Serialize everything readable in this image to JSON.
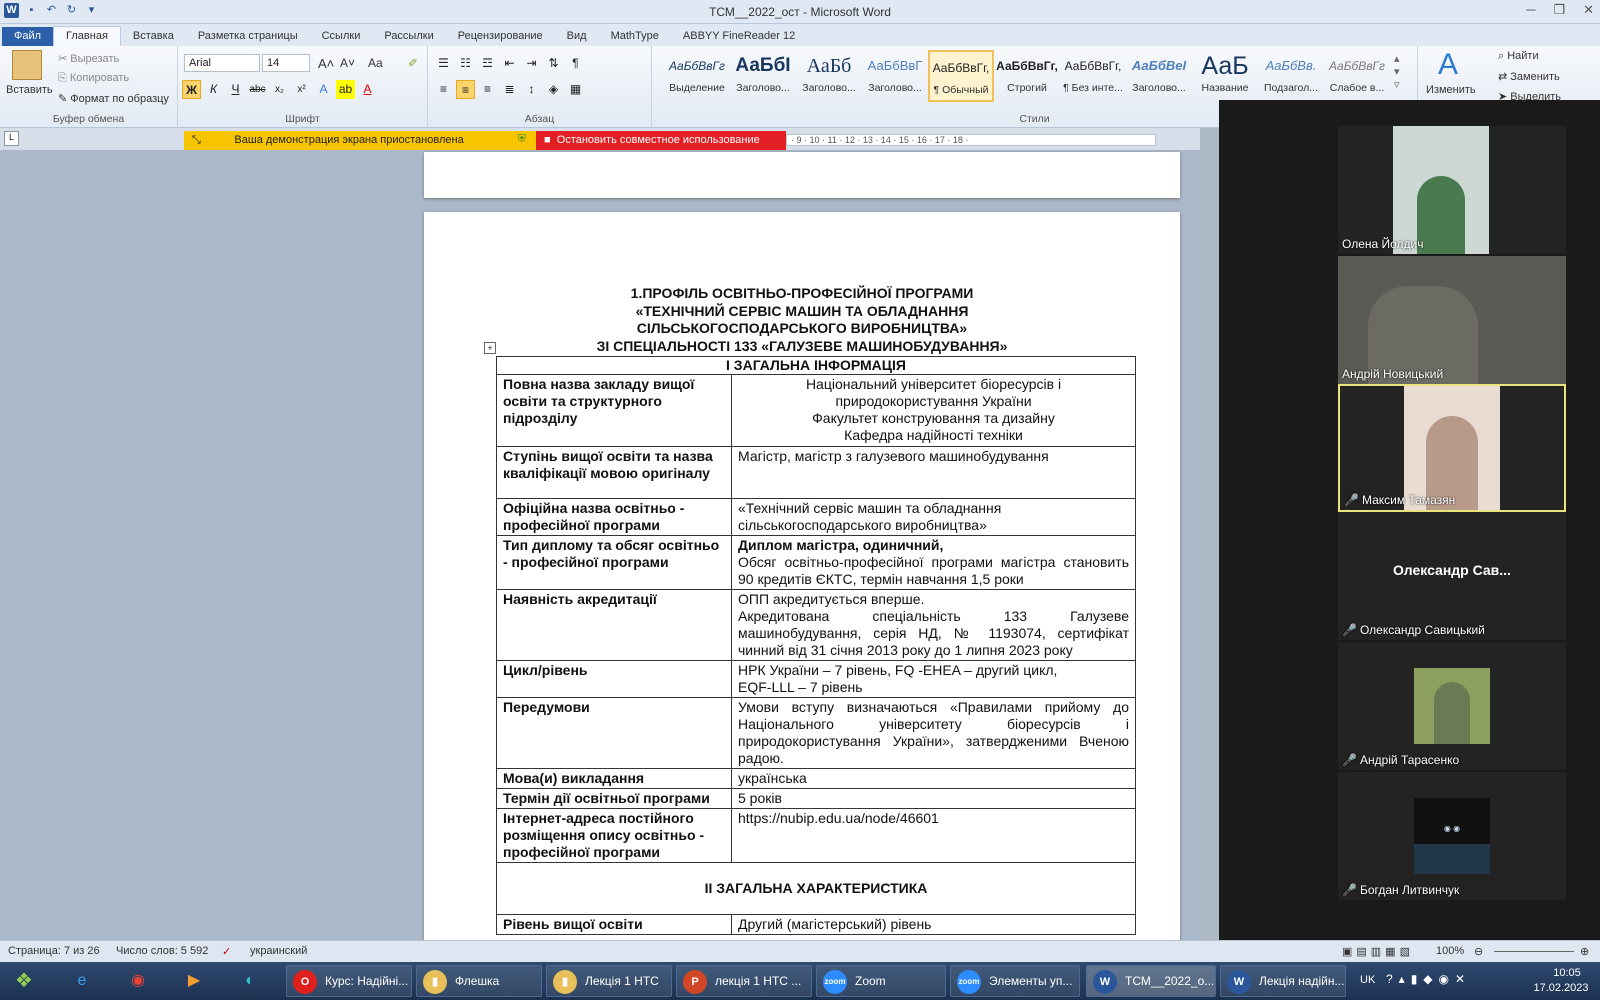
{
  "window": {
    "title": "ТСМ__2022_ост  -  Microsoft Word",
    "app_icon": "W"
  },
  "tabs": [
    "Файл",
    "Главная",
    "Вставка",
    "Разметка страницы",
    "Ссылки",
    "Рассылки",
    "Рецензирование",
    "Вид",
    "MathType",
    "ABBYY FineReader 12"
  ],
  "clipboard": {
    "paste": "Вставить",
    "cut": "Вырезать",
    "copy": "Копировать",
    "painter": "Формат по образцу",
    "label": "Буфер обмена"
  },
  "font": {
    "name": "Arial",
    "size": "14",
    "label": "Шрифт",
    "case_label": "Aa"
  },
  "paragraph": {
    "label": "Абзац"
  },
  "styles": {
    "label": "Стили",
    "items": [
      {
        "sample": "АаБбВвГг",
        "name": "Выделение"
      },
      {
        "sample": "АаБбІ",
        "name": "Заголово..."
      },
      {
        "sample": "АаБб",
        "name": "Заголово..."
      },
      {
        "sample": "АаБбВвГ",
        "name": "Заголово..."
      },
      {
        "sample": "АаБбВвГг,",
        "name": "¶ Обычный"
      },
      {
        "sample": "АаБбВвГг,",
        "name": "Строгий"
      },
      {
        "sample": "АаБбВвГг,",
        "name": "¶ Без инте..."
      },
      {
        "sample": "АаБбВеІ",
        "name": "Заголово..."
      },
      {
        "sample": "АаБ",
        "name": "Название"
      },
      {
        "sample": "АаБбВв.",
        "name": "Подзагол..."
      },
      {
        "sample": "АаБбВвГг",
        "name": "Слабое в..."
      }
    ],
    "change": "Изменить"
  },
  "editing": {
    "find": "Найти",
    "replace": "Заменить",
    "select": "Выделить"
  },
  "share": {
    "paused": "Ваша демонстрация экрана приостановлена",
    "stop": "Остановить совместное использование"
  },
  "ruler": "· 9 · 10 · 11 · 12 · 13 · 14 · 15 · 16 · 17 · 18 ·",
  "document": {
    "title_lines": [
      "1.ПРОФІЛЬ ОСВІТНЬО-ПРОФЕСІЙНОЇ ПРОГРАМИ",
      "«ТЕХНІЧНИЙ СЕРВІС МАШИН ТА ОБЛАДНАННЯ",
      "СІЛЬСЬКОГОСПОДАРСЬКОГО ВИРОБНИЦТВА»",
      "ЗІ СПЕЦІАЛЬНОСТІ 133 «ГАЛУЗЕВЕ МАШИНОБУДУВАННЯ»"
    ],
    "section1": "І  ЗАГАЛЬНА ІНФОРМАЦІЯ",
    "rows": [
      {
        "key": "Повна назва закладу вищої освіти та структурного підрозділу",
        "value": [
          "Національний університет біоресурсів і",
          "природокористування України",
          "Факультет конструювання та дизайну",
          "Кафедра надійності техніки"
        ]
      },
      {
        "key": "Ступінь вищої освіти та назва кваліфікації мовою оригіналу",
        "value": [
          "Магістр, магістр з галузевого машинобудування"
        ]
      },
      {
        "key": "Офіційна назва освітньо - професійної програми",
        "value": [
          "«Технічний сервіс машин та обладнання сільськогосподарського виробництва»"
        ]
      },
      {
        "key": "Тип диплому та обсяг освітньо - професійної програми",
        "value_bold": "Диплом магістра, одиничний,",
        "value": [
          "Обсяг освітньо-професійної програми магістра становить 90 кредитів ЄКТС, термін навчання 1,5 роки"
        ]
      },
      {
        "key": "Наявність акредитації",
        "value": [
          "ОПП акредитується вперше.",
          "Акредитована спеціальність 133 Галузеве машинобудування, серія НД, № 1193074, сертифікат чинний від 31 січня 2013 року до 1 липня 2023 року"
        ]
      },
      {
        "key": "Цикл/рівень",
        "value": [
          "НРК України – 7 рівень, FQ -EHEA – другий цикл,",
          "EQF-LLL – 7 рівень"
        ]
      },
      {
        "key": "Передумови",
        "value": [
          "Умови вступу визначаються «Правилами прийому до Національного університету біоресурсів і природокористування України», затвердженими Вченою радою."
        ]
      },
      {
        "key": "Мова(и) викладання",
        "value": [
          "українська"
        ]
      },
      {
        "key": "Термін дії освітньої програми",
        "value": [
          "5 років"
        ]
      },
      {
        "key": "Інтернет-адреса постійного розміщення опису освітньо - професійної програми",
        "value": [
          "https://nubip.edu.ua/node/46601"
        ]
      }
    ],
    "section2": "ІІ ЗАГАЛЬНА ХАРАКТЕРИСТИКА",
    "last_row": {
      "key": "Рівень вищої освіти",
      "value": "Другий (магістерський) рівень"
    }
  },
  "zoom": {
    "participants": [
      {
        "name": "Олена Йолдич",
        "muted": false,
        "video": true,
        "color": "#4a7a4f"
      },
      {
        "name": "Андрій Новицький",
        "muted": false,
        "video": true,
        "color": "#6b6a63"
      },
      {
        "name": "Максим Тамазян",
        "muted": true,
        "video": true,
        "color": "#b89a8a",
        "active": true
      },
      {
        "name": "Олександр Савицький",
        "short": "Олександр  Сав...",
        "muted": true,
        "video": false
      },
      {
        "name": "Андрій Тарасенко",
        "muted": true,
        "video": true,
        "color": "#6a7a52"
      },
      {
        "name": "Богдан Литвинчук",
        "muted": true,
        "video": true,
        "color": "#22364a"
      }
    ]
  },
  "status": {
    "page": "Страница: 7 из 26",
    "words": "Число слов: 5 592",
    "lang": "украинский",
    "zoom": "100%"
  },
  "taskbar": {
    "items": [
      {
        "label": "Курс: Надійні...",
        "icon": "O",
        "color": "#e0201c"
      },
      {
        "label": "Флешка",
        "icon": "▮",
        "color": "#e8c05a"
      },
      {
        "label": "Лекція 1 НТС",
        "icon": "▮",
        "color": "#e8c05a"
      },
      {
        "label": "лекція 1 НТС ...",
        "icon": "P",
        "color": "#d24726"
      },
      {
        "label": "Zoom",
        "icon": "zoom",
        "color": "#2d8cff"
      },
      {
        "label": "Элементы уп...",
        "icon": "zoom",
        "color": "#2d8cff"
      },
      {
        "label": "ТСМ__2022_о...",
        "icon": "W",
        "color": "#2b579a"
      },
      {
        "label": "Лекція надійн...",
        "icon": "W",
        "color": "#2b579a"
      }
    ],
    "lang": "UK",
    "time": "10:05",
    "date": "17.02.2023"
  }
}
